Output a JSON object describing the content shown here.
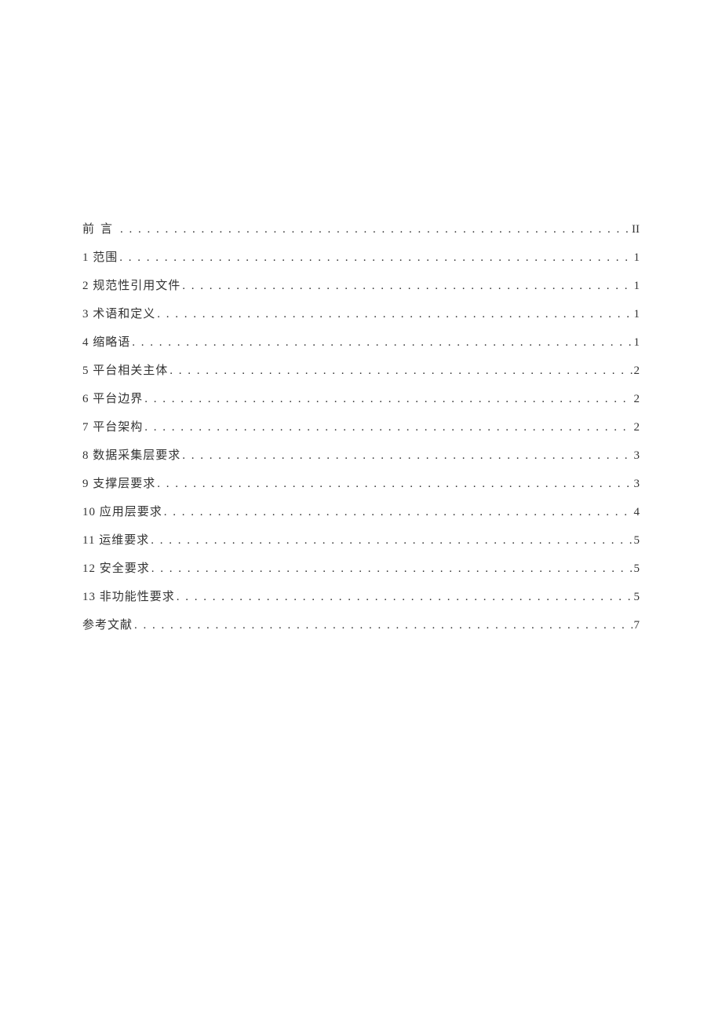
{
  "toc": {
    "entries": [
      {
        "label": "前言",
        "page": "II",
        "spaced": true
      },
      {
        "label": "1 范围",
        "page": "1",
        "spaced": false
      },
      {
        "label": "2 规范性引用文件",
        "page": "1",
        "spaced": false
      },
      {
        "label": "3 术语和定义",
        "page": "1",
        "spaced": false
      },
      {
        "label": "4 缩略语",
        "page": "1",
        "spaced": false
      },
      {
        "label": "5 平台相关主体",
        "page": "2",
        "spaced": false
      },
      {
        "label": "6 平台边界",
        "page": "2",
        "spaced": false
      },
      {
        "label": "7 平台架构",
        "page": "2",
        "spaced": false
      },
      {
        "label": "8 数据采集层要求",
        "page": "3",
        "spaced": false
      },
      {
        "label": "9 支撑层要求",
        "page": "3",
        "spaced": false
      },
      {
        "label": "10 应用层要求",
        "page": "4",
        "spaced": false
      },
      {
        "label": "11 运维要求",
        "page": "5",
        "spaced": false
      },
      {
        "label": "12 安全要求",
        "page": "5",
        "spaced": false
      },
      {
        "label": "13 非功能性要求",
        "page": "5",
        "spaced": false
      },
      {
        "label": "参考文献",
        "page": "7",
        "spaced": false
      }
    ]
  }
}
